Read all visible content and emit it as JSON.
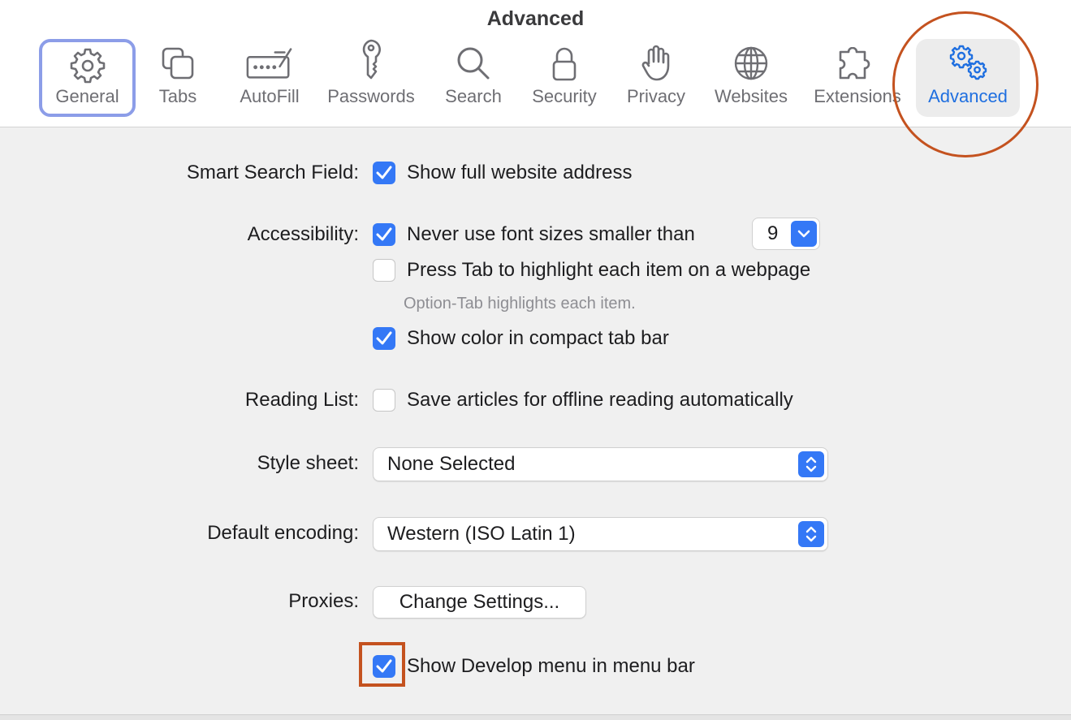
{
  "window": {
    "title": "Advanced"
  },
  "toolbar": {
    "tabs": [
      {
        "label": "General",
        "icon": "gear-icon"
      },
      {
        "label": "Tabs",
        "icon": "tabs-icon"
      },
      {
        "label": "AutoFill",
        "icon": "autofill-icon"
      },
      {
        "label": "Passwords",
        "icon": "key-icon"
      },
      {
        "label": "Search",
        "icon": "search-icon"
      },
      {
        "label": "Security",
        "icon": "lock-icon"
      },
      {
        "label": "Privacy",
        "icon": "hand-icon"
      },
      {
        "label": "Websites",
        "icon": "globe-icon"
      },
      {
        "label": "Extensions",
        "icon": "puzzle-icon"
      },
      {
        "label": "Advanced",
        "icon": "gears-icon"
      }
    ],
    "selected_tab": "Advanced",
    "focused_tab": "General"
  },
  "settings": {
    "smart_search": {
      "label": "Smart Search Field:",
      "option": "Show full website address",
      "checked": true
    },
    "accessibility": {
      "label": "Accessibility:",
      "min_font": {
        "option": "Never use font sizes smaller than",
        "checked": true,
        "value": "9"
      },
      "press_tab": {
        "option": "Press Tab to highlight each item on a webpage",
        "checked": false,
        "hint": "Option-Tab highlights each item."
      },
      "compact_color": {
        "option": "Show color in compact tab bar",
        "checked": true
      }
    },
    "reading_list": {
      "label": "Reading List:",
      "option": "Save articles for offline reading automatically",
      "checked": false
    },
    "style_sheet": {
      "label": "Style sheet:",
      "value": "None Selected"
    },
    "default_encoding": {
      "label": "Default encoding:",
      "value": "Western (ISO Latin 1)"
    },
    "proxies": {
      "label": "Proxies:",
      "button": "Change Settings..."
    },
    "develop_menu": {
      "option": "Show Develop menu in menu bar",
      "checked": true
    }
  },
  "colors": {
    "accent": "#3478f6",
    "selected_tab_text": "#1f6fe0",
    "annotation": "#c4521f",
    "focus_ring": "#8c9de8"
  }
}
